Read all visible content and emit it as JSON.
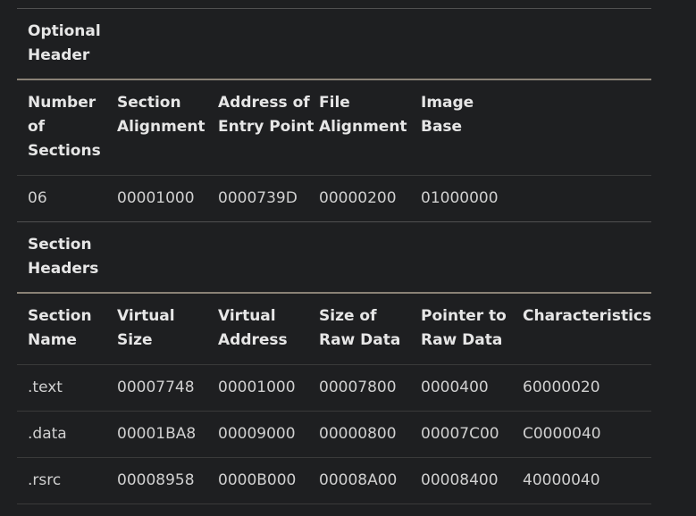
{
  "optional_header": {
    "title": "Optional Header",
    "columns": [
      "Number of Sections",
      "Section Alignment",
      "Address of Entry Point",
      "File Alignment",
      "Image Base"
    ],
    "values": [
      "06",
      "00001000",
      "0000739D",
      "00000200",
      "01000000"
    ]
  },
  "section_headers": {
    "title": "Section Headers",
    "columns": [
      "Section Name",
      "Virtual Size",
      "Virtual Address",
      "Size of Raw Data",
      "Pointer to Raw Data",
      "Characteristics"
    ],
    "rows": [
      [
        ".text",
        "00007748",
        "00001000",
        "00007800",
        "0000400",
        "60000020"
      ],
      [
        ".data",
        "00001BA8",
        "00009000",
        "00000800",
        "00007C00",
        "C0000040"
      ],
      [
        ".rsrc",
        "00008958",
        "0000B000",
        "00008A00",
        "00008400",
        "40000040"
      ]
    ]
  }
}
